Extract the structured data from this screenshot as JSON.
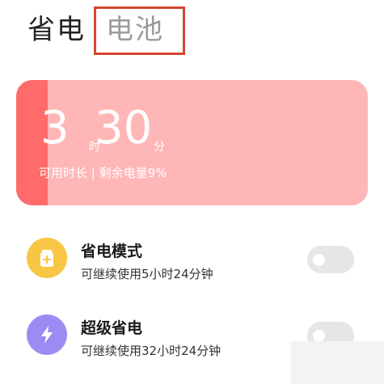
{
  "header": {
    "tab_power_saving": "省电",
    "tab_battery": "电池",
    "highlight_color": "#d6462f"
  },
  "battery": {
    "hours": "3",
    "hours_unit": "时",
    "minutes": "30",
    "minutes_unit": "分",
    "remaining_label": "可用时长 | 剩余电量9%",
    "level_percent": 9,
    "fill_color": "#ff6b6b",
    "card_color": "#ffb6b6"
  },
  "modes": [
    {
      "title": "省电模式",
      "subtitle": "可继续使用5小时24分钟",
      "icon": "battery-plus-icon",
      "icon_color": "#f7c644",
      "enabled": false
    },
    {
      "title": "超级省电",
      "subtitle": "可继续使用32小时24分钟",
      "icon": "lightning-bolt-icon",
      "icon_color": "#9b8cf4",
      "enabled": false
    }
  ]
}
